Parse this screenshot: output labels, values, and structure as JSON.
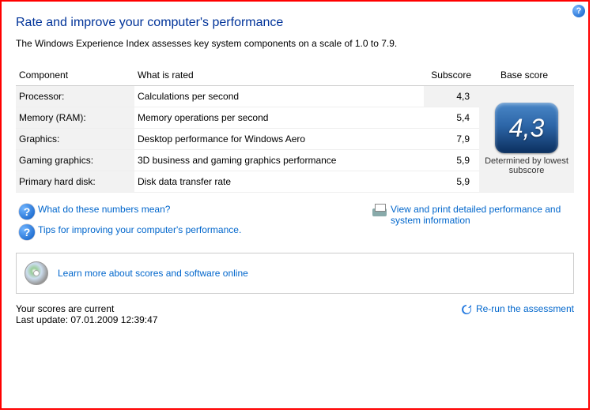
{
  "header": {
    "title": "Rate and improve your computer's performance",
    "intro": "The Windows Experience Index assesses key system components on a scale of 1.0 to 7.9."
  },
  "table": {
    "headers": {
      "component": "Component",
      "rated": "What is rated",
      "subscore": "Subscore",
      "basescore": "Base score"
    },
    "rows": [
      {
        "component": "Processor:",
        "rated": "Calculations per second",
        "subscore": "4,3",
        "highlight": true
      },
      {
        "component": "Memory (RAM):",
        "rated": "Memory operations per second",
        "subscore": "5,4"
      },
      {
        "component": "Graphics:",
        "rated": "Desktop performance for Windows Aero",
        "subscore": "7,9"
      },
      {
        "component": "Gaming graphics:",
        "rated": "3D business and gaming graphics performance",
        "subscore": "5,9"
      },
      {
        "component": "Primary hard disk:",
        "rated": "Disk data transfer rate",
        "subscore": "5,9"
      }
    ],
    "base": {
      "value": "4,3",
      "caption": "Determined by lowest subscore"
    }
  },
  "links": {
    "what_numbers": "What do these numbers mean?",
    "tips": "Tips for improving your computer's performance.",
    "view_print": "View and print detailed performance and system information",
    "learn_more": "Learn more about scores and software online",
    "rerun": "Re-run the assessment"
  },
  "status": {
    "current": "Your scores are current",
    "last_update": "Last update: 07.01.2009 12:39:47"
  }
}
